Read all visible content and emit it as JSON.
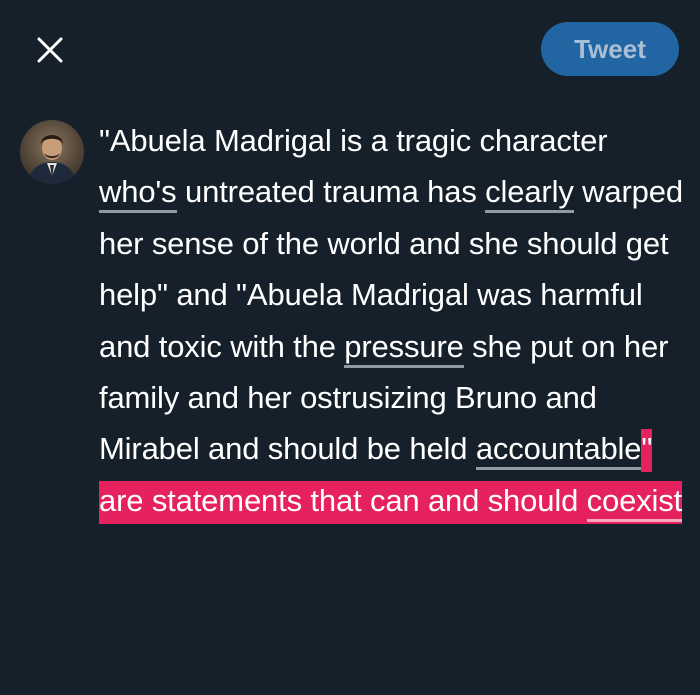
{
  "header": {
    "close_icon": "close-icon",
    "tweet_button_label": "Tweet",
    "tweet_button_color": "#2165a3"
  },
  "composer": {
    "text_segments": [
      {
        "text": "\"Abuela Madrigal is a tragic character ",
        "style": "plain"
      },
      {
        "text": "who's",
        "style": "underline"
      },
      {
        "text": " untreated trauma has ",
        "style": "plain"
      },
      {
        "text": "clearly",
        "style": "underline"
      },
      {
        "text": " warped her sense of the world and she should get help\" and \"Abuela Madrigal was harmful and toxic with the ",
        "style": "plain"
      },
      {
        "text": "pressure",
        "style": "underline"
      },
      {
        "text": " she put on her family and her ostrusizing Bruno and Mirabel and should be held ",
        "style": "plain"
      },
      {
        "text": "accountable",
        "style": "underline"
      },
      {
        "text": "\" are statements that can and should ",
        "style": "highlight"
      },
      {
        "text": "coexist",
        "style": "highlight-underline"
      }
    ],
    "highlight_color": "#e5225e",
    "background_color": "#15202b"
  }
}
